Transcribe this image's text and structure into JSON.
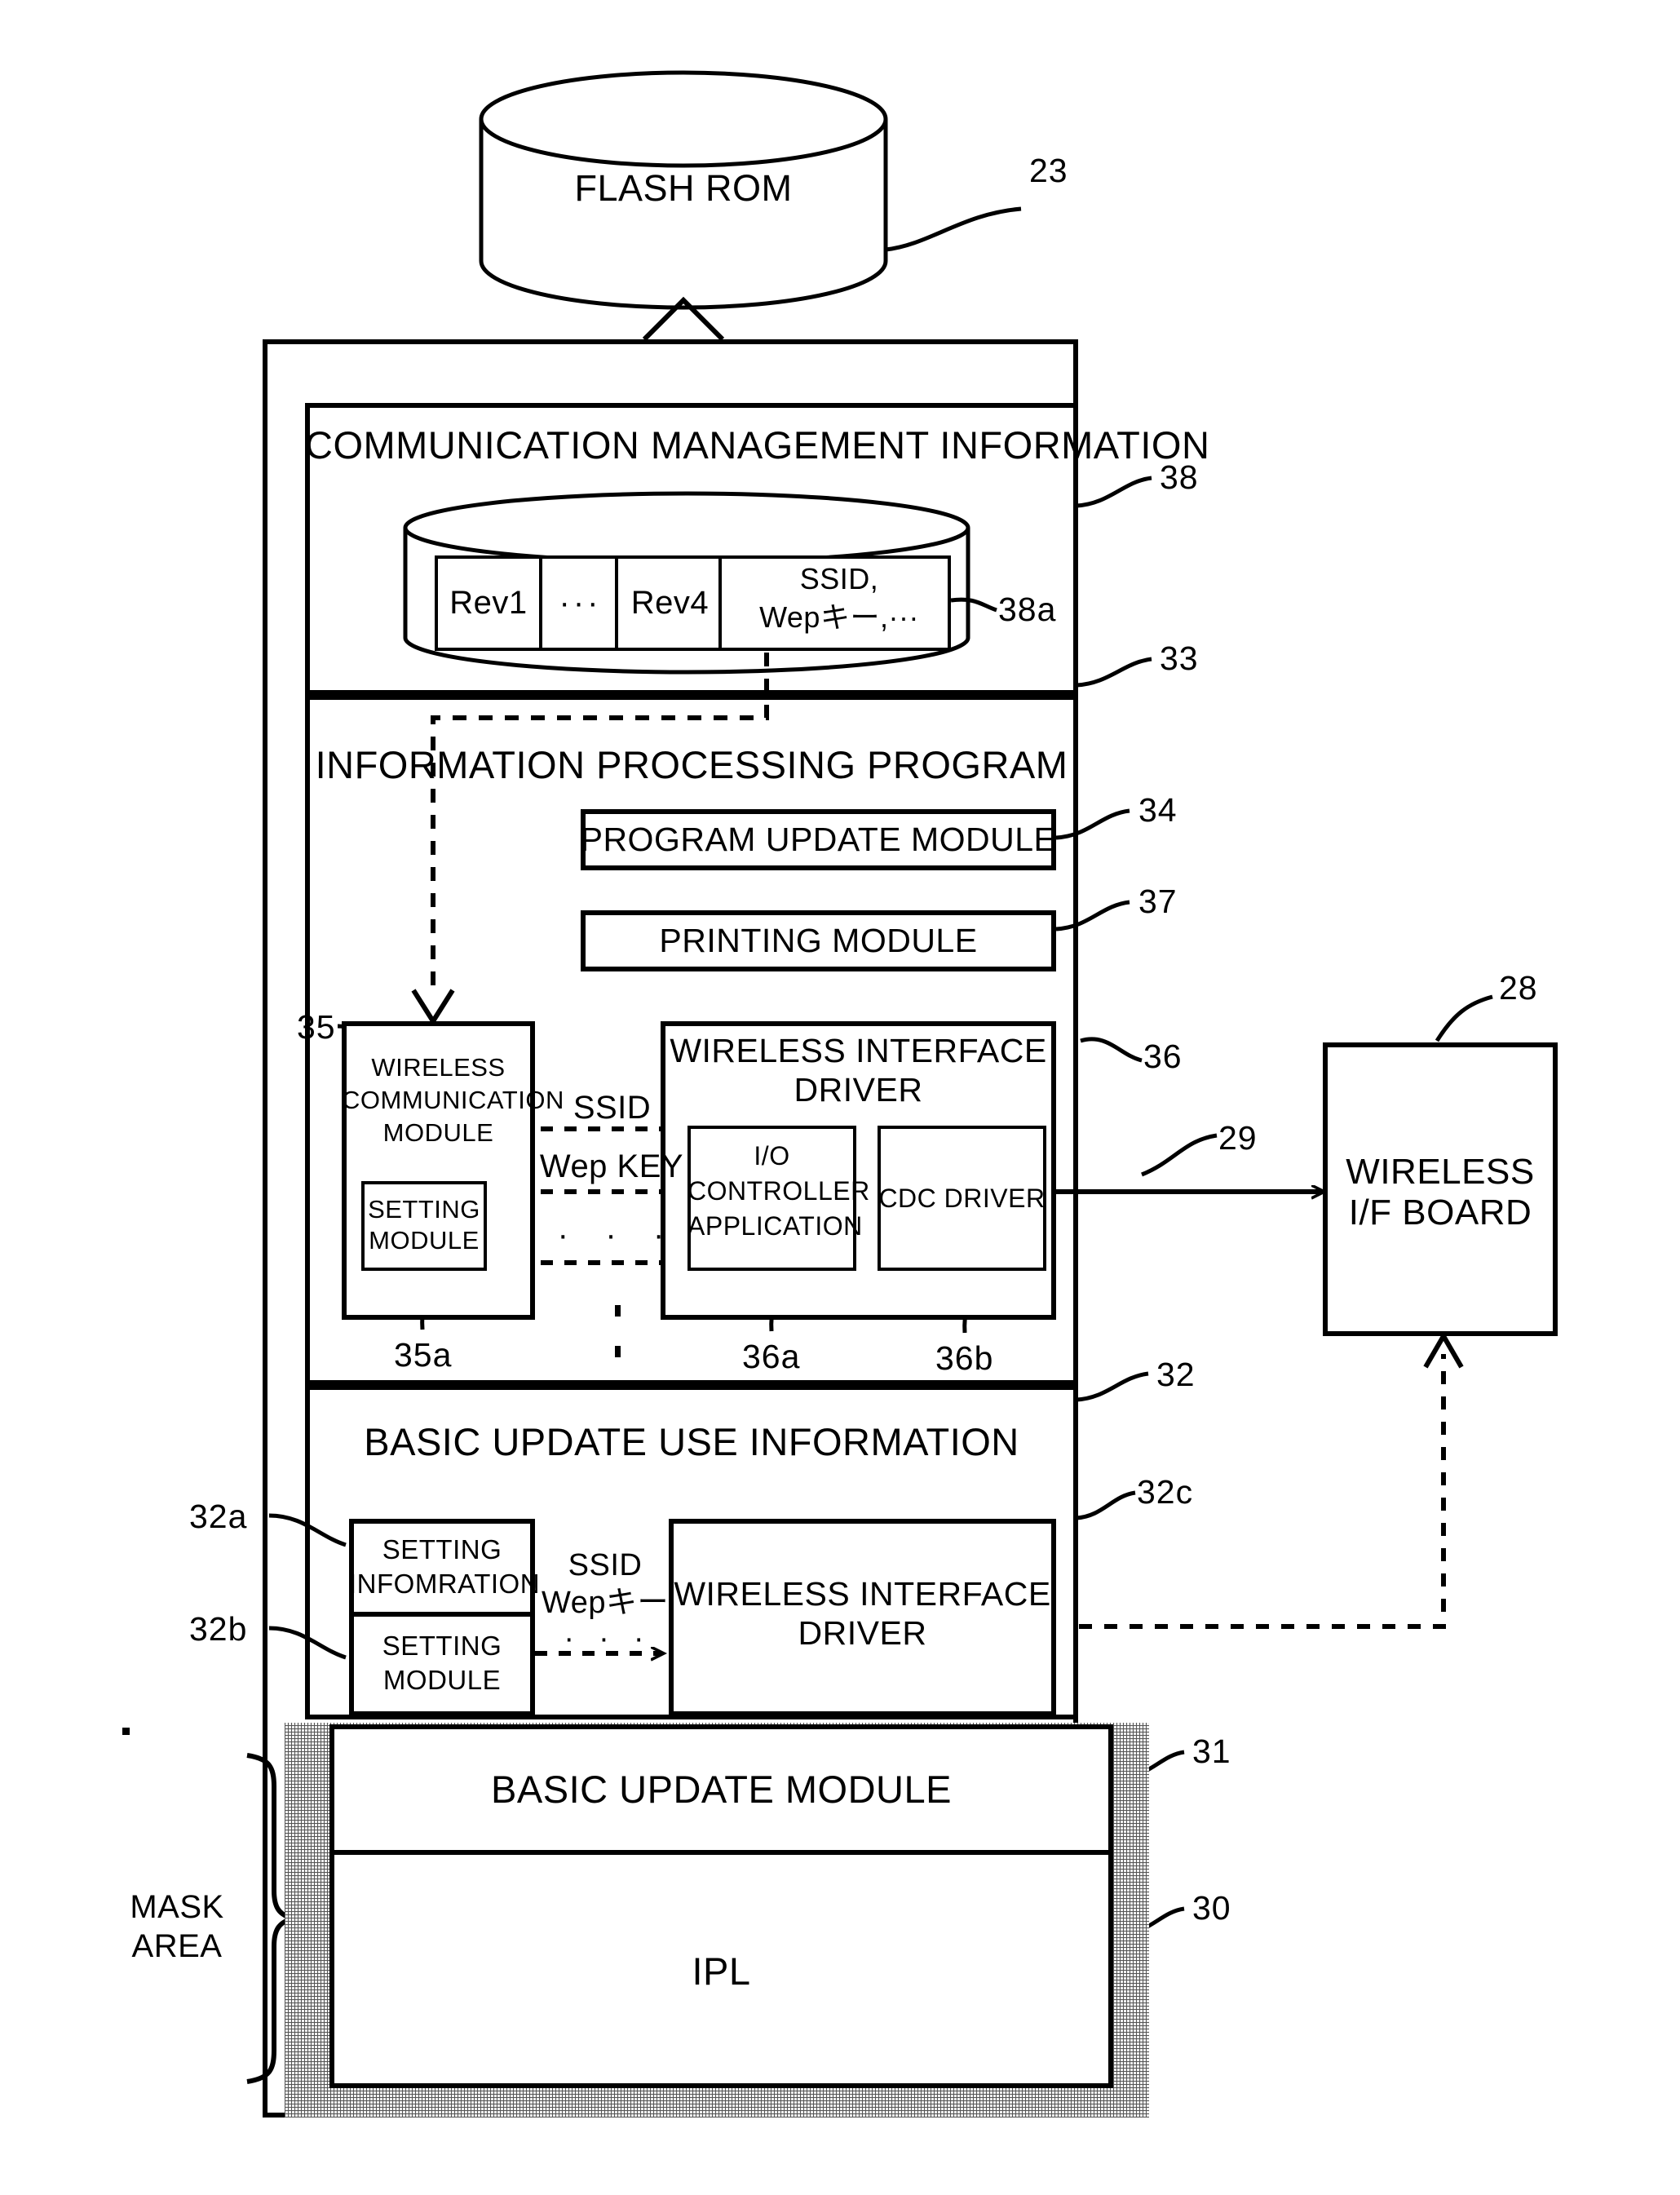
{
  "figure": {
    "type": "patent-block-diagram",
    "storage": {
      "label": "FLASH ROM",
      "ref": "23"
    },
    "comm_mgmt": {
      "title": "COMMUNICATION MANAGEMENT INFORMATION",
      "ref": "38",
      "table": {
        "ref": "38a",
        "cells": [
          {
            "text": "Rev1"
          },
          {
            "text": "···"
          },
          {
            "text": "Rev4"
          },
          {
            "line1": "SSID,",
            "line2": "Wepキー,···"
          }
        ]
      }
    },
    "info_proc": {
      "title": "INFORMATION PROCESSING PROGRAM",
      "ref": "33",
      "program_update_module": {
        "label": "PROGRAM UPDATE MODULE",
        "ref": "34"
      },
      "printing_module": {
        "label": "PRINTING MODULE",
        "ref": "37"
      },
      "wireless_comm_module": {
        "line1": "WIRELESS",
        "line2": "COMMUNICATION",
        "line3": "MODULE",
        "ref": "35"
      },
      "setting_module": {
        "line1": "SETTING",
        "line2": "MODULE",
        "ref": "35a"
      },
      "wireless_if_driver": {
        "line1": "WIRELESS INTERFACE",
        "line2": "DRIVER",
        "ref": "36"
      },
      "io_controller_app": {
        "line1": "I/O",
        "line2": "CONTROLLER",
        "line3": "APPLICATION",
        "ref": "36a"
      },
      "cdc_driver": {
        "label": "CDC DRIVER",
        "ref": "36b"
      },
      "flow_labels": {
        "ssid": "SSID",
        "wep_key": "Wep KEY",
        "ellipsis": "·   ·   ·"
      }
    },
    "basic_update_info": {
      "title": "BASIC UPDATE USE INFORMATION",
      "ref": "32",
      "setting_information": {
        "line1": "SETTING",
        "line2": "INFOMRATION",
        "ref": "32a"
      },
      "setting_module": {
        "line1": "SETTING",
        "line2": "MODULE",
        "ref": "32b"
      },
      "wireless_if_driver": {
        "line1": "WIRELESS INTERFACE",
        "line2": "DRIVER",
        "ref": "32c"
      },
      "flow_labels": {
        "ssid": "SSID",
        "wep_key": "Wepキー",
        "ellipsis": "·  ·  ·"
      }
    },
    "mask_area": {
      "label_line1": "MASK",
      "label_line2": "AREA",
      "basic_update_module": {
        "label": "BASIC UPDATE MODULE",
        "ref": "31"
      },
      "ipl": {
        "label": "IPL",
        "ref": "30"
      }
    },
    "wireless_board": {
      "line1": "WIRELESS",
      "line2": "I/F BOARD",
      "ref": "28"
    },
    "connection_ref": "29"
  }
}
